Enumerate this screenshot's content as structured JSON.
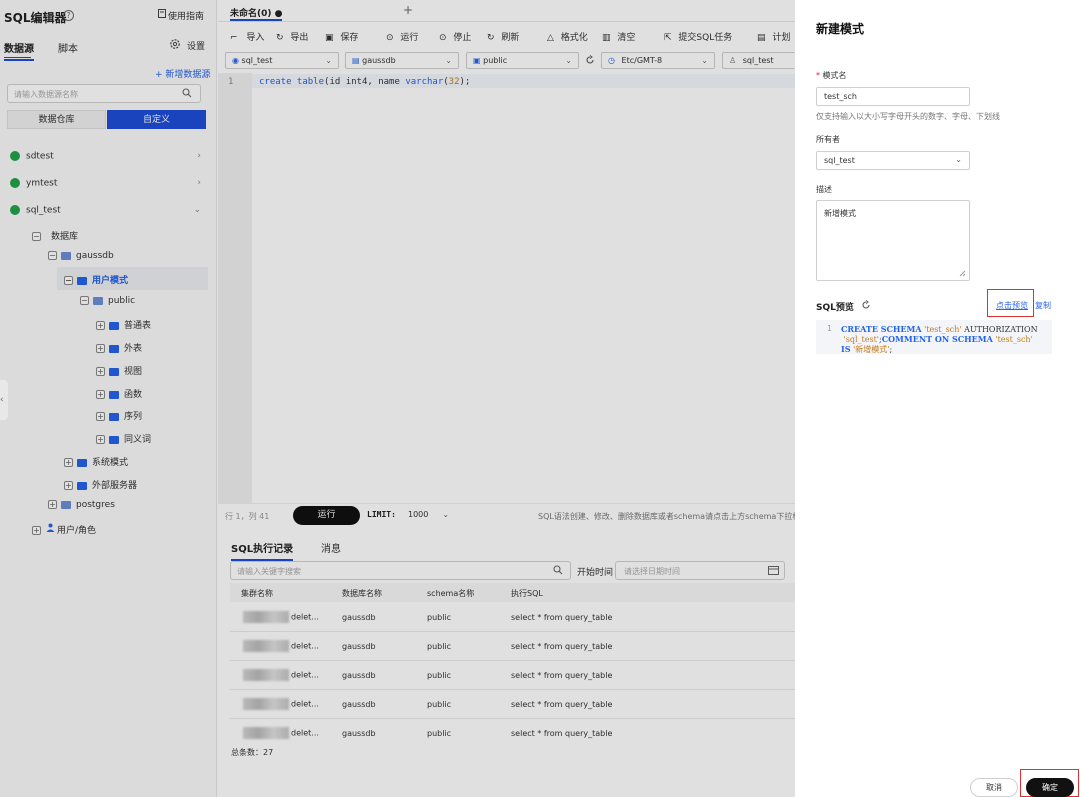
{
  "sidebar": {
    "title": "SQL编辑器",
    "help_icon": "?",
    "guide": "使用指南",
    "tabs": [
      "数据源",
      "脚本"
    ],
    "settings": "设置",
    "add_datasource": "+ 新增数据源",
    "search_placeholder": "请输入数据源名称",
    "segments": [
      "数据仓库",
      "自定义"
    ],
    "datasources": [
      "sdtest",
      "ymtest",
      "sql_test"
    ],
    "tree": {
      "database": "数据库",
      "gaussdb": "gaussdb",
      "user_schema": "用户模式",
      "public": "public",
      "objects": [
        "普通表",
        "外表",
        "视图",
        "函数",
        "序列",
        "同义词"
      ],
      "system_schema": "系统模式",
      "foreign_server": "外部服务器",
      "postgres": "postgres",
      "users_roles": "用户/角色"
    }
  },
  "editor": {
    "tab_name": "未命名(0)",
    "tab_dot": "●",
    "tab_add": "+",
    "toolbar": [
      "导入",
      "导出",
      "保存",
      "运行",
      "停止",
      "刷新",
      "格式化",
      "清空",
      "提交SQL任务",
      "计划"
    ],
    "selectors": {
      "datasource": "sql_test",
      "database": "gaussdb",
      "schema": "public",
      "timezone": "Etc/GMT-8",
      "user": "sql_test"
    },
    "line_number": "1",
    "code": {
      "kw1": "create table",
      "p1": "(id int4, name ",
      "kw2": "varchar",
      "p2": "(",
      "num": "32",
      "p3": ");"
    },
    "position": "行 1，列 41",
    "run": "运行",
    "limit_label": "LIMIT:",
    "limit_value": "1000",
    "hint": "SQL语法创建、修改、删除数据库或者schema请点击上方schema下拉框"
  },
  "results": {
    "tabs": [
      "SQL执行记录",
      "消息"
    ],
    "search_placeholder": "请输入关键字搜索",
    "start_time": "开始时间",
    "date_placeholder": "请选择日期时间",
    "columns": [
      "集群名称",
      "数据库名称",
      "schema名称",
      "执行SQL"
    ],
    "rows": [
      {
        "cluster": "delet...",
        "db": "gaussdb",
        "schema": "public",
        "sql": "select * from query_table"
      },
      {
        "cluster": "delet...",
        "db": "gaussdb",
        "schema": "public",
        "sql": "select * from query_table"
      },
      {
        "cluster": "delet...",
        "db": "gaussdb",
        "schema": "public",
        "sql": "select * from query_table"
      },
      {
        "cluster": "delet...",
        "db": "gaussdb",
        "schema": "public",
        "sql": "select * from query_table"
      },
      {
        "cluster": "delet...",
        "db": "gaussdb",
        "schema": "public",
        "sql": "select * from query_table"
      }
    ],
    "total": "总条数：27"
  },
  "drawer": {
    "title": "新建模式",
    "schema_name_label": "模式名",
    "required_mark": "*",
    "schema_name_value": "test_sch",
    "schema_name_hint": "仅支持输入以大小写字母开头的数字、字母、下划线",
    "owner_label": "所有者",
    "owner_value": "sql_test",
    "desc_label": "描述",
    "desc_value": "新增模式",
    "sql_preview_label": "SQL预览",
    "preview_link": "点击预览",
    "copy_link": "复制",
    "sql_line_no": "1",
    "sql": {
      "l1_kw": "CREATE SCHEMA",
      "l1_str": " 'test_sch'",
      "l1_rest": " AUTHORIZATION",
      "l2_str": " 'sql_test'",
      "l2_p": ";",
      "l2_kw": "COMMENT ON SCHEMA",
      "l2_str2": " 'test_sch'",
      "l3_kw": "IS",
      "l3_str": " '新增模式'",
      "l3_p": ";"
    },
    "cancel": "取消",
    "confirm": "确定"
  },
  "colors": {
    "accent": "#1d4ed8",
    "link": "#2563eb",
    "db_green": "#22a34a",
    "highlight_red": "#e03131",
    "button_dark": "#111111"
  }
}
